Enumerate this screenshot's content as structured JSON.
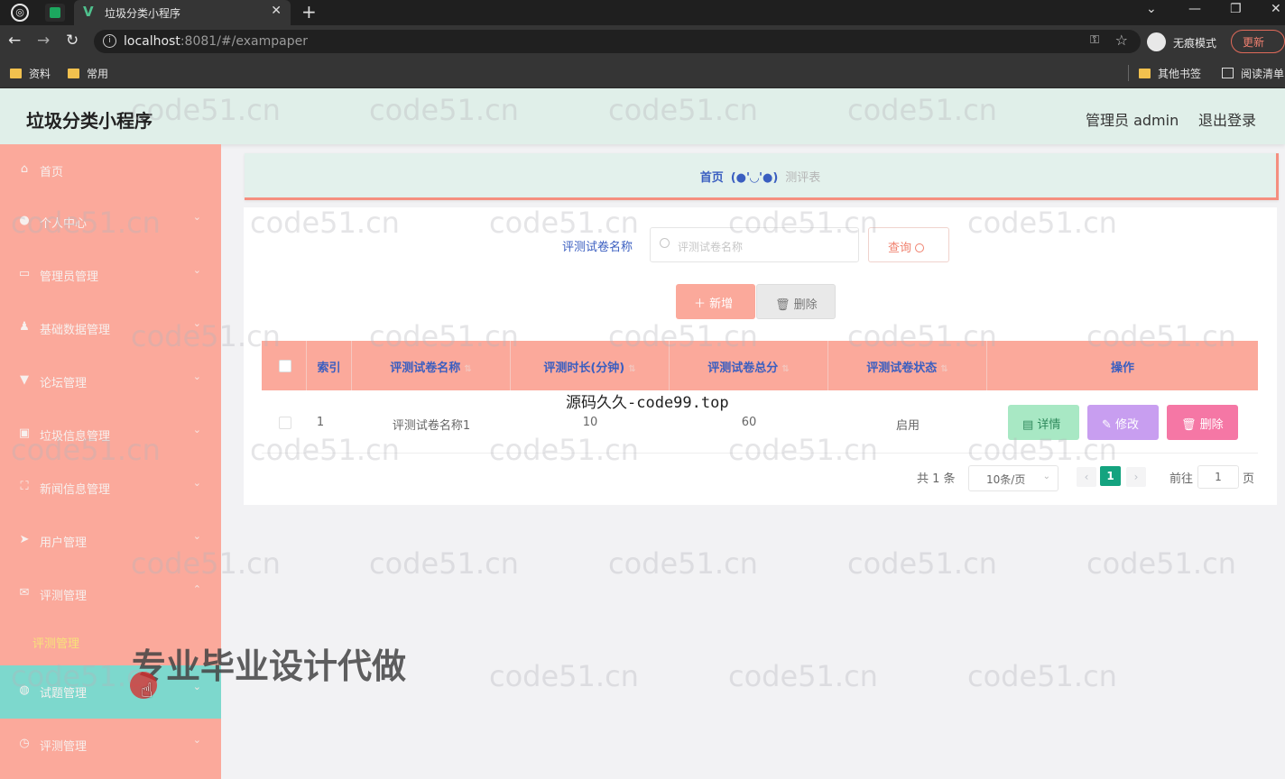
{
  "browser": {
    "tab_title": "垃圾分类小程序",
    "url_host": "localhost",
    "url_rest": ":8081/#/exampaper",
    "incognito_label": "无痕模式",
    "update_label": "更新",
    "bookmarks": [
      "资料",
      "常用"
    ],
    "other_bookmarks": "其他书签",
    "reading_list": "阅读清单"
  },
  "header": {
    "title": "垃圾分类小程序",
    "user": "管理员 admin",
    "logout": "退出登录"
  },
  "sidebar": {
    "items": [
      {
        "label": "首页",
        "icon": "home-icon"
      },
      {
        "label": "个人中心",
        "icon": "user-icon"
      },
      {
        "label": "管理员管理",
        "icon": "admin-icon"
      },
      {
        "label": "基础数据管理",
        "icon": "data-icon"
      },
      {
        "label": "论坛管理",
        "icon": "forum-icon"
      },
      {
        "label": "垃圾信息管理",
        "icon": "trash-icon"
      },
      {
        "label": "新闻信息管理",
        "icon": "news-icon"
      },
      {
        "label": "用户管理",
        "icon": "send-icon"
      },
      {
        "label": "评测管理",
        "icon": "mail-icon"
      },
      {
        "label": "试题管理",
        "icon": "globe-icon"
      },
      {
        "label": "评测管理",
        "icon": "clock-icon"
      }
    ],
    "subitem": "评测管理"
  },
  "breadcrumb": {
    "home": "首页",
    "face": "(●'◡'●)",
    "current": "测评表"
  },
  "search": {
    "label": "评测试卷名称",
    "placeholder": "评测试卷名称",
    "query_label": "查询"
  },
  "actions": {
    "add_label": "新增",
    "delete_label": "删除"
  },
  "table": {
    "columns": [
      "索引",
      "评测试卷名称",
      "评测时长(分钟)",
      "评测试卷总分",
      "评测试卷状态",
      "操作"
    ],
    "rows": [
      {
        "index": "1",
        "name": "评测试卷名称1",
        "duration": "10",
        "score": "60",
        "status": "启用"
      }
    ],
    "ops": {
      "detail": "详情",
      "edit": "修改",
      "delete": "删除"
    }
  },
  "pagination": {
    "total": "共 1 条",
    "page_size": "10条/页",
    "current": "1",
    "goto_label": "前往",
    "goto_value": "1",
    "page_suffix": "页"
  },
  "overlays": {
    "watermark": "code51.cn",
    "site": "源码久久-code99.top",
    "promo": "专业毕业设计代做"
  },
  "colors": {
    "sidebar": "#fba99b",
    "active_menu": "#7dd8cd",
    "header": "#e0efe9",
    "link_blue": "#3a5ec0",
    "page_active": "#14a37f",
    "detail_btn": "#a8e8c4",
    "edit_btn": "#c89ef0",
    "delete_btn": "#f577a5"
  }
}
